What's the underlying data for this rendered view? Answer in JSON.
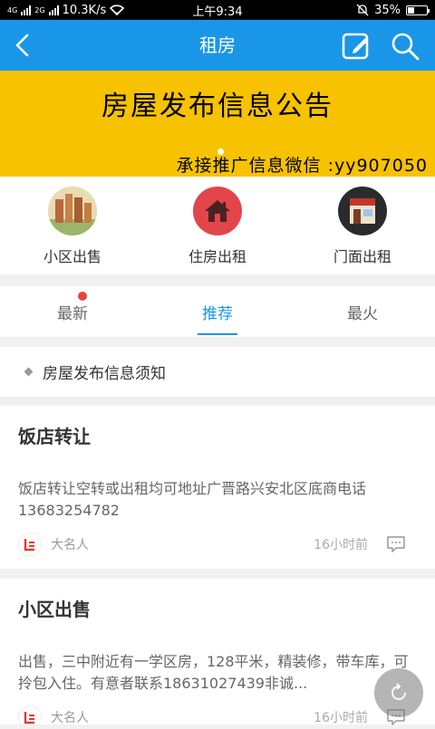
{
  "status": {
    "signal_left": "4G",
    "signal_right": "2G",
    "speed": "10.3K/s",
    "time": "上午9:34",
    "battery": "35%",
    "battery_level": 0.35
  },
  "nav": {
    "title": "租房"
  },
  "banner": {
    "headline": "房屋发布信息公告",
    "subline": "承接推广信息微信 :yy907050"
  },
  "categories": [
    {
      "label": "小区出售",
      "icon": "apartment-photo-icon"
    },
    {
      "label": "住房出租",
      "icon": "house-icon"
    },
    {
      "label": "门面出租",
      "icon": "storefront-icon"
    }
  ],
  "tabs": [
    {
      "label": "最新",
      "badge": true
    },
    {
      "label": "推荐",
      "active": true
    },
    {
      "label": "最火"
    }
  ],
  "notice": {
    "text": "房屋发布信息须知"
  },
  "posts": [
    {
      "title": "饭店转让",
      "body": "饭店转让空转或出租均可地址广晋路兴安北区底商电话 13683254782",
      "author": "大名人",
      "time": "16小时前"
    },
    {
      "title": "小区出售",
      "body": "出售，三中附近有一学区房，128平米，精装修，带车库，可拎包入住。有意者联系18631027439非诚...",
      "author": "大名人",
      "time": "16小时前"
    }
  ],
  "colors": {
    "primary": "#1a96e8",
    "banner": "#f7c200",
    "badge": "#e8463b"
  }
}
